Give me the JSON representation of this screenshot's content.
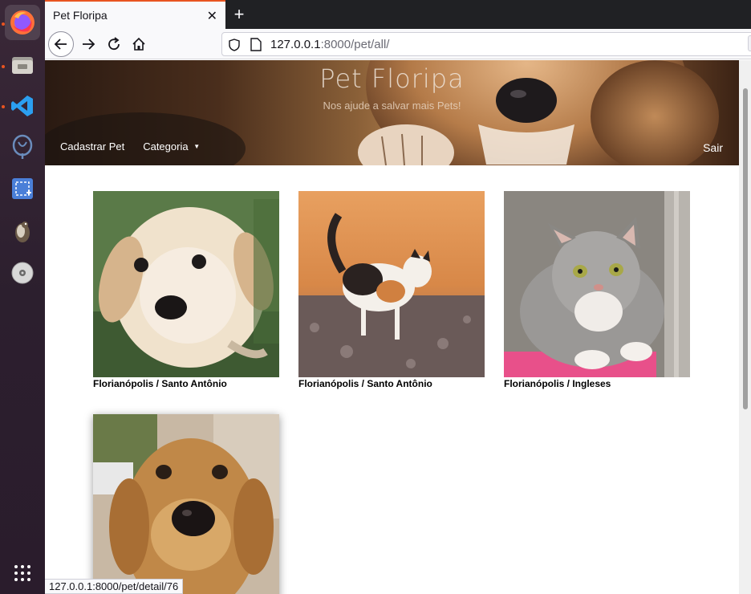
{
  "browser": {
    "tab_title": "Pet Floripa",
    "url_host": "127.0.0.1",
    "url_path": ":8000/pet/all/",
    "zoom": "8",
    "status_url": "127.0.0.1:8000/pet/detail/76"
  },
  "site": {
    "title": "Pet Floripa",
    "subtitle": "Nos ajude a salvar mais Pets!",
    "nav": {
      "register": "Cadastrar Pet",
      "category": "Categoria",
      "logout": "Sair"
    }
  },
  "pets": [
    {
      "location": "Florianópolis / Santo Antônio",
      "animal": "puppy"
    },
    {
      "location": "Florianópolis / Santo Antônio",
      "animal": "cat"
    },
    {
      "location": "Florianópolis / Ingleses",
      "animal": "kitten"
    },
    {
      "location": "",
      "animal": "dog"
    }
  ],
  "dock": [
    "firefox-icon",
    "files-icon",
    "vscode-icon",
    "pgadmin-icon",
    "screenshot-icon",
    "gimp-icon",
    "disc-icon",
    "apps-grid-icon"
  ]
}
